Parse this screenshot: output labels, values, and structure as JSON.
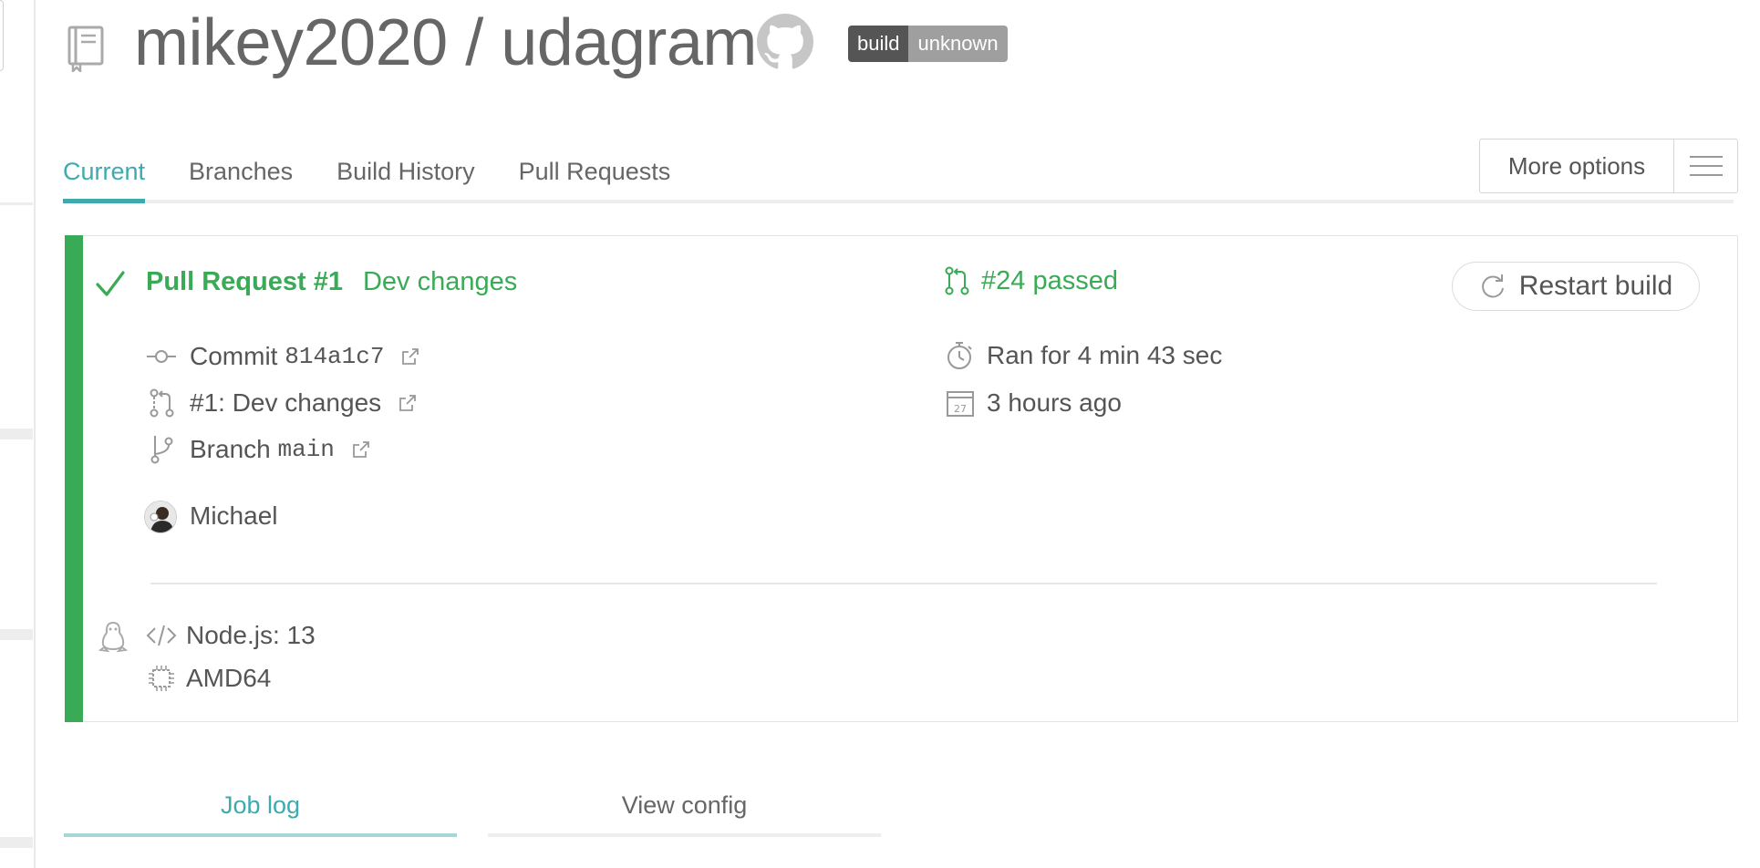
{
  "repo": {
    "owner": "mikey2020",
    "separator": " / ",
    "name": "udagram"
  },
  "badge": {
    "left": "build",
    "right": "unknown"
  },
  "tabs": [
    "Current",
    "Branches",
    "Build History",
    "Pull Requests"
  ],
  "more_options_label": "More options",
  "build": {
    "pr_number": "Pull Request #1",
    "pr_title": "Dev changes",
    "commit_label": "Commit",
    "commit_sha": "814a1c7",
    "pr_link": "#1: Dev changes",
    "branch_label": "Branch",
    "branch_name": "main",
    "author": "Michael",
    "status": "#24 passed",
    "restart_label": "Restart build",
    "duration": "Ran for 4 min 43 sec",
    "finished": "3 hours ago",
    "calendar_day": "27",
    "language": "Node.js: 13",
    "arch": "AMD64"
  },
  "bottom_tabs": {
    "job_log": "Job log",
    "view_config": "View config"
  },
  "colors": {
    "passed": "#39aa56",
    "accent": "#3eaaaf"
  }
}
